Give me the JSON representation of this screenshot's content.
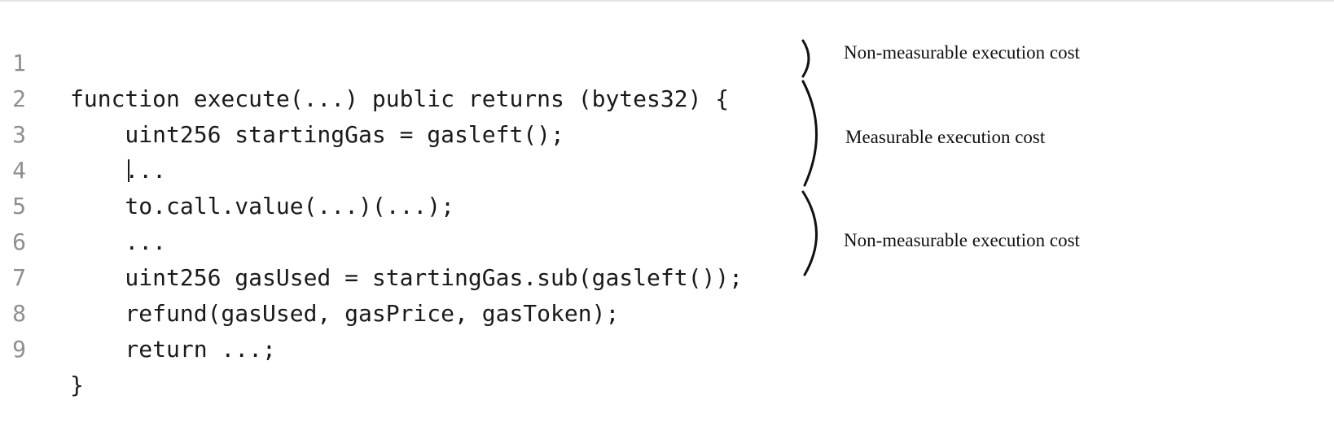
{
  "code": {
    "lines": [
      {
        "number": "1",
        "text": "function execute(...) public returns (bytes32) {"
      },
      {
        "number": "2",
        "text": "    uint256 startingGas = gasleft();"
      },
      {
        "number": "3",
        "text": "    ..."
      },
      {
        "number": "4",
        "text": "    to.call.value(...)(...);"
      },
      {
        "number": "5",
        "text": "    ..."
      },
      {
        "number": "6",
        "text": "    uint256 gasUsed = startingGas.sub(gasleft());"
      },
      {
        "number": "7",
        "text": "    refund(gasUsed, gasPrice, gasToken);"
      },
      {
        "number": "8",
        "text": "    return ...;"
      },
      {
        "number": "9",
        "text": "}"
      }
    ]
  },
  "annotations": [
    {
      "label": "Non-measurable execution cost"
    },
    {
      "label": "Measurable execution cost"
    },
    {
      "label": "Non-measurable execution cost"
    }
  ]
}
